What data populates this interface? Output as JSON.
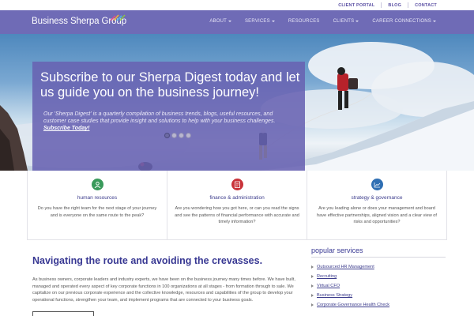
{
  "toplinks": [
    "CLIENT PORTAL",
    "BLOG",
    "CONTACT"
  ],
  "brand": {
    "name": "Business Sherpa Group"
  },
  "nav": [
    {
      "label": "ABOUT",
      "dropdown": true
    },
    {
      "label": "SERVICES",
      "dropdown": true
    },
    {
      "label": "RESOURCES",
      "dropdown": false
    },
    {
      "label": "CLIENTS",
      "dropdown": true
    },
    {
      "label": "CAREER CONNECTIONS",
      "dropdown": true
    }
  ],
  "hero": {
    "title": "Subscribe to our Sherpa Digest today and let us guide you on the business journey!",
    "text": "Our 'Sherpa Digest' is a quarterly compilation of business trends, blogs, useful resources, and customer case studies that provide insight and solutions to help with your business challenges.",
    "cta": "Subscribe Today!",
    "slides": 4,
    "active_slide": 1
  },
  "cards": [
    {
      "icon": "people-icon",
      "color": "#3a9a5b",
      "title": "human resources",
      "text": "Do you have the right team for the next stage of your journey and is everyone on the same route to the peak?"
    },
    {
      "icon": "clipboard-icon",
      "color": "#c9343a",
      "title": "finance & administration",
      "text": "Are you wondering how you got here, or can you read the signs and see the patterns of financial performance with accurate and timely information?"
    },
    {
      "icon": "growth-chart-icon",
      "color": "#2f6fb3",
      "title": "strategy & governance",
      "text": "Are you leading alone or does your management and board have effective partnerships, aligned vision and a clear view of risks and opportunities?"
    }
  ],
  "main": {
    "headline": "Navigating the route and avoiding the crevasses.",
    "body": "As business owners, corporate leaders and industry experts, we have been on the business journey many times before. We have built, managed and operated every aspect of key corporate functions in 100 organizations at all stages - from formation through to sale. We capitalize on our previous corporate experience and the collective knowledge, resources and capabilities of the group to develop your operational functions, strengthen your team, and implement programs that are connected to your business goals."
  },
  "sidebar": {
    "title": "popular services",
    "items": [
      "Outsourced HR Management",
      "Recruiting",
      "Virtual CFO",
      "Business Strategy",
      "Corporate Governance Health Check"
    ]
  },
  "colors": {
    "nav": "#6f6bb6",
    "accent": "#383893",
    "hero_box": "#6862b2"
  }
}
